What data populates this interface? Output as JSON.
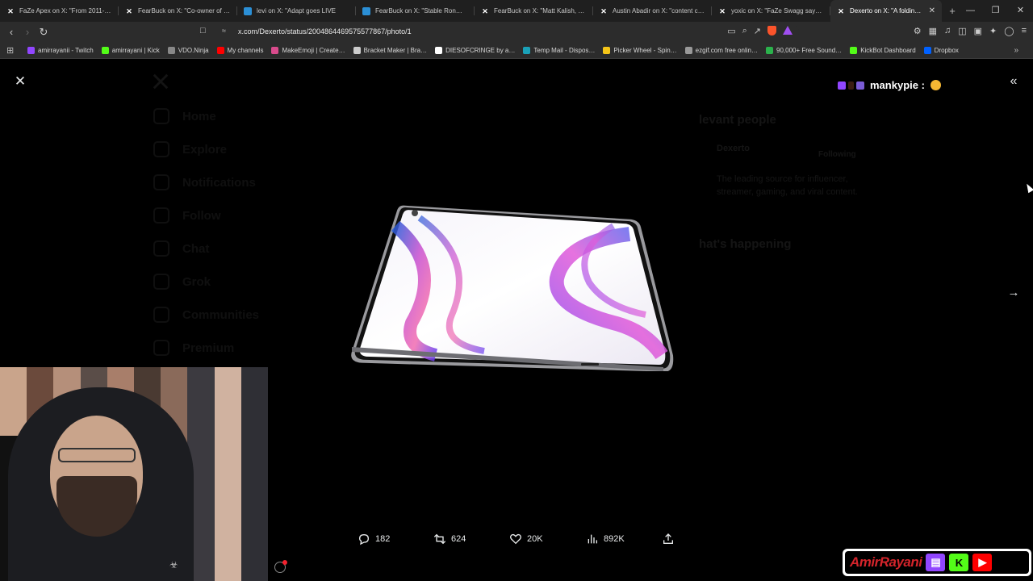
{
  "browser": {
    "tabs": [
      {
        "icon": "x",
        "title": "FaZe Apex on X: \"From 2011-2…",
        "active": false
      },
      {
        "icon": "x",
        "title": "FearBuck on X: \"Co-owner of F…",
        "active": false
      },
      {
        "icon": "x-blue",
        "title": "levi on X: \"Adapt goes LIVE",
        "active": false
      },
      {
        "icon": "x-blue",
        "title": "FearBuck on X: \"Stable Ron…",
        "active": false
      },
      {
        "icon": "x",
        "title": "FearBuck on X: \"Matt Kalish, co…",
        "active": false
      },
      {
        "icon": "x",
        "title": "Austin Abadir on X: \"content c…",
        "active": false
      },
      {
        "icon": "x",
        "title": "yoxic on X: \"FaZe Swagg says…",
        "active": false
      },
      {
        "icon": "x",
        "title": "Dexerto on X: \"A folding i…",
        "active": true
      }
    ],
    "url": "x.com/Dexerto/status/2004864469575577867/photo/1",
    "bookmarks": [
      {
        "label": "amirrayanii - Twitch",
        "color": "#9146ff"
      },
      {
        "label": "amirrayani | Kick",
        "color": "#53fc18"
      },
      {
        "label": "VDO.Ninja",
        "color": "#888888"
      },
      {
        "label": "My channels",
        "color": "#ff0000"
      },
      {
        "label": "MakeEmoji | Create…",
        "color": "#d94b8c"
      },
      {
        "label": "Bracket Maker | Bra…",
        "color": "#cccccc"
      },
      {
        "label": "DIESOFCRINGE by a…",
        "color": "#ffffff"
      },
      {
        "label": "Temp Mail - Dispos…",
        "color": "#1aa1b8"
      },
      {
        "label": "Picker Wheel - Spin…",
        "color": "#f5c518"
      },
      {
        "label": "ezgif.com free onlin…",
        "color": "#999999"
      },
      {
        "label": "90,000+ Free Sound…",
        "color": "#2bb24c"
      },
      {
        "label": "KickBot Dashboard",
        "color": "#53fc18"
      },
      {
        "label": "Dropbox",
        "color": "#0061ff"
      }
    ]
  },
  "viewer": {
    "chat_username": "mankypie :",
    "stats": {
      "replies": "182",
      "reposts": "624",
      "likes": "20K",
      "views": "892K"
    }
  },
  "background_page": {
    "nav": [
      "Home",
      "Explore",
      "Notifications",
      "Follow",
      "Chat",
      "Grok",
      "Communities",
      "Premium"
    ],
    "relevant_heading": "levant people",
    "account": "Dexerto",
    "follow_state": "Following",
    "bio": "The leading source for influencer, streamer, gaming, and viral content.",
    "happening_heading": "hat's happening"
  },
  "overlay": {
    "brand_name": "AmirRayani"
  }
}
